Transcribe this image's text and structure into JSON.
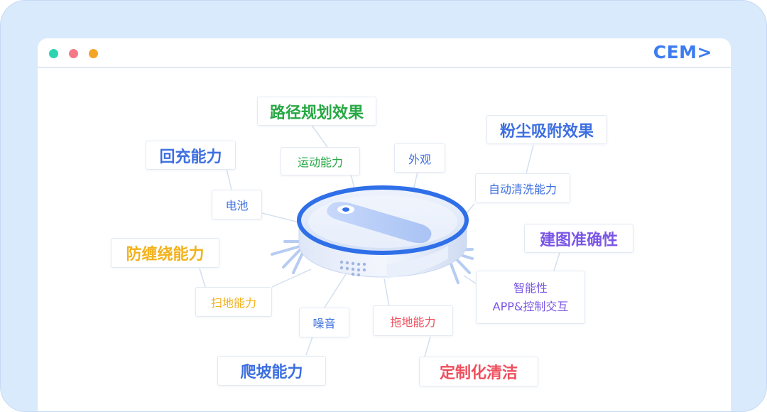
{
  "brand": {
    "text": "CEM>",
    "color": "#3d7cf0"
  },
  "window_dots": [
    {
      "color": "#2cd4b0"
    },
    {
      "color": "#f57a86"
    },
    {
      "color": "#f5a524"
    }
  ],
  "icons": {
    "center": "robot-vacuum-icon"
  },
  "colors": {
    "blue": "#3d6fe0",
    "green": "#27a844",
    "yellow": "#f2b21b",
    "purple": "#7a55e6",
    "red": "#ef4f5e",
    "line": "#d3e0f0"
  },
  "labels": {
    "path_planning": "路径规划效果",
    "dust_suction": "粉尘吸附效果",
    "recharge": "回充能力",
    "motion": "运动能力",
    "appearance": "外观",
    "self_cleaning": "自动清洗能力",
    "battery": "电池",
    "anti_tangle": "防缠绕能力",
    "mapping": "建图准确性",
    "sweeping": "扫地能力",
    "intelligence_1": "智能性",
    "intelligence_2": "APP&控制交互",
    "noise": "噪音",
    "mopping": "拖地能力",
    "climbing": "爬坡能力",
    "custom_cleaning": "定制化清洁"
  }
}
